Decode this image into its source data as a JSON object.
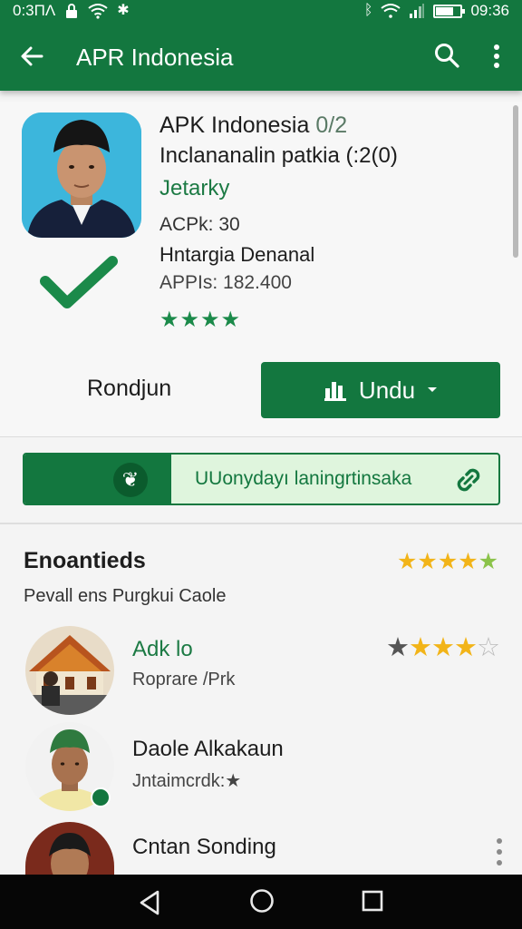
{
  "status_bar": {
    "left_text": "0:3ΠΛ",
    "time": "09:36",
    "battery_level": 0.7,
    "icons": [
      "lock-icon",
      "wifi-icon",
      "sync-icon",
      "bluetooth-icon",
      "wifi-icon",
      "signal-icon",
      "battery-icon"
    ]
  },
  "app_bar": {
    "title": "APR Indonesia",
    "icons": [
      "back-arrow-icon",
      "search-icon",
      "more-vert-icon"
    ]
  },
  "app_card": {
    "title": "APK Indonesia",
    "title_suffix": "0/2",
    "subtitle": "Inclananalin patkia (:2(0)",
    "category": "Jetarky",
    "acpk": "ACPk: 30",
    "developer": "Hntargia Denanal",
    "apps": "APPIs: 182.400",
    "star_rating": "★★★★",
    "rating_value": 4,
    "secondary_action": "Rondjun",
    "install_button": "Undu"
  },
  "promo_strip": {
    "text": "UUonydayı laningrtinsaka"
  },
  "list_section": {
    "title": "Enoantieds",
    "subtitle": "Pevall ens Purgkui Caole",
    "header_stars": "★★★★★",
    "items": [
      {
        "name": "Adk lo",
        "sub": "Roprare /Prk",
        "stars": "★★★★★",
        "rating": 3.5
      },
      {
        "name": "Daole Alkakaun",
        "sub": "Jntaimcrdk:★"
      },
      {
        "name": "Cntan Sonding",
        "sub": ""
      }
    ]
  },
  "colors": {
    "brand_green": "#13773f",
    "light_green": "#dff5dd",
    "gold_star": "#f2b418",
    "navbar": "#060606"
  }
}
